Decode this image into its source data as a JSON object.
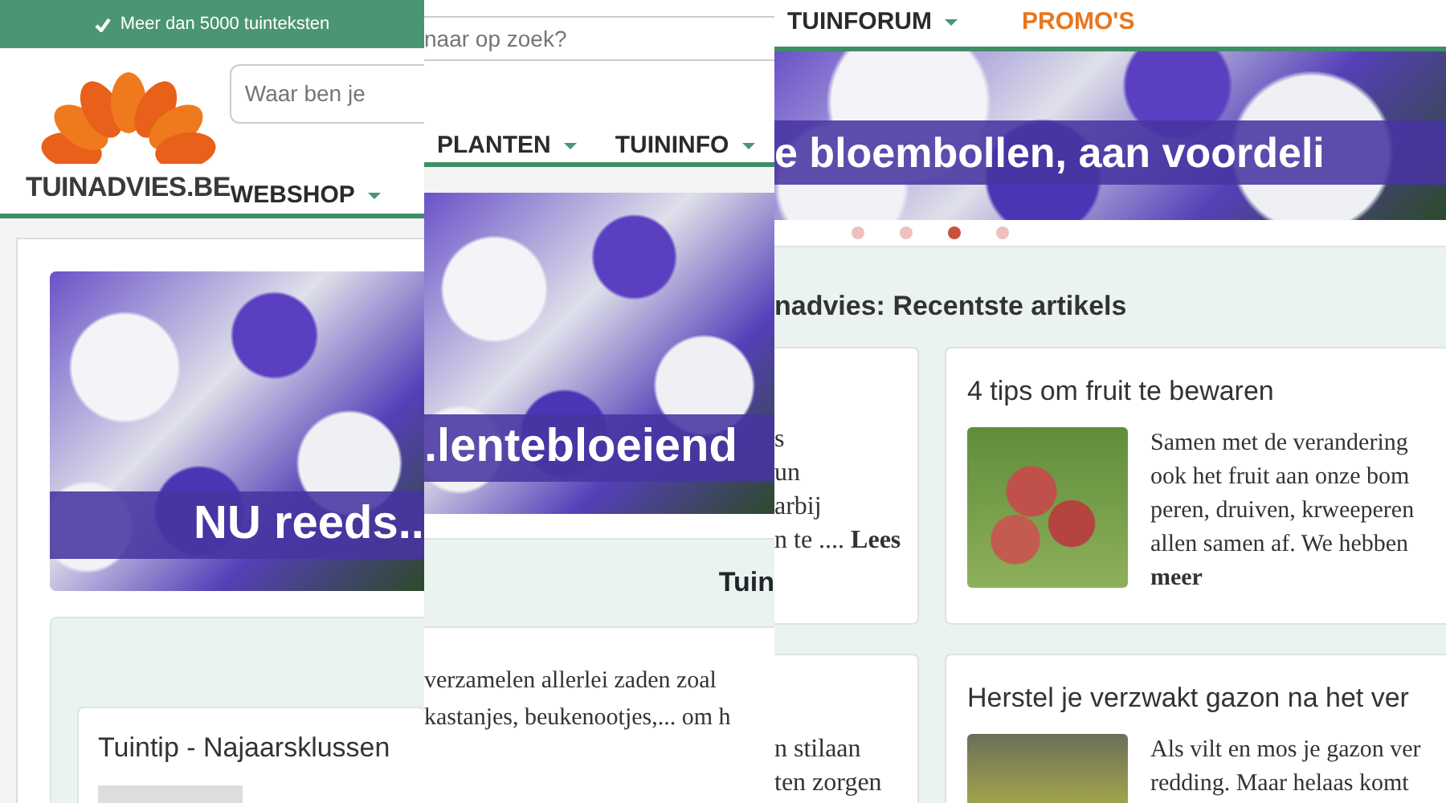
{
  "left_frame": {
    "top_bar": {
      "text": "Meer dan 5000 tuinteksten"
    },
    "logo": {
      "text": "TUINADVIES.BE"
    },
    "search": {
      "placeholder": "Waar ben je"
    },
    "nav": [
      {
        "label": "WEBSHOP",
        "dropdown": true,
        "highlight": false
      }
    ],
    "banner": {
      "caption": "NU reeds.."
    },
    "cards": [
      {
        "title": "Tuintip - Najaarsklussen"
      }
    ]
  },
  "middle_frame": {
    "search": {
      "placeholder": "naar op zoek?"
    },
    "nav": [
      {
        "label": "PLANTEN",
        "dropdown": true,
        "highlight": false
      },
      {
        "label": "TUININFO",
        "dropdown": true,
        "highlight": false
      }
    ],
    "banner": {
      "caption": ".lentebloeiend"
    },
    "section": {
      "heading": "Tuin",
      "text": "verzamelen allerlei zaden zoal\nkastanjes, beukenootjes,... om h"
    }
  },
  "right_frame": {
    "nav": [
      {
        "label": "TUINFORUM",
        "dropdown": true,
        "highlight": false
      },
      {
        "label": "PROMO'S",
        "dropdown": false,
        "highlight": true
      }
    ],
    "banner": {
      "caption": "e bloembollen, aan voordeli"
    },
    "carousel_dots": [
      {
        "selected": false
      },
      {
        "selected": false
      },
      {
        "selected": true
      },
      {
        "selected": false
      }
    ],
    "section": {
      "heading": "nadvies: Recentste artikels",
      "cut_cards": [
        {
          "text": "s\nun\narbij\nn te .... **Lees**"
        },
        {
          "text": "n stilaan\nten zorgen"
        }
      ],
      "articles": [
        {
          "title": "4 tips om fruit te bewaren",
          "text": "Samen met de verandering\nook het fruit aan onze bom\nperen, druiven, krweeperen\nallen samen af. We hebben\n**meer**"
        },
        {
          "title": "Herstel je verzwakt gazon na het ver",
          "text": "Als vilt en mos je gazon ver\nredding. Maar helaas komt"
        }
      ]
    }
  }
}
